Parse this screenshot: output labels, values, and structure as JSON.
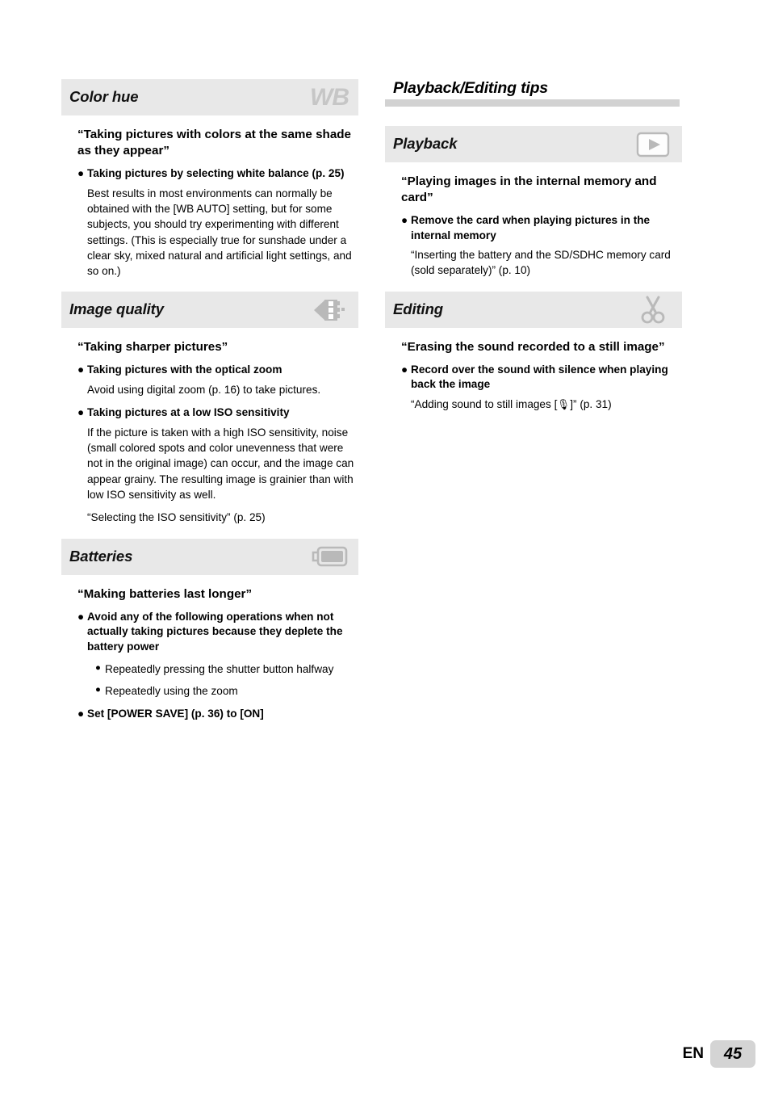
{
  "page": {
    "language_code": "EN",
    "page_number": "45"
  },
  "left_column": {
    "sections": [
      {
        "title": "Color hue",
        "icon": "white-balance-wb-icon",
        "icon_label": "WB",
        "quoted_heading": "“Taking pictures with colors at the same shade as they appear”",
        "bullets": [
          {
            "level": 1,
            "bold": true,
            "text": "Taking pictures by selecting white balance (p. 25)"
          }
        ],
        "paragraphs": [
          "Best results in most environments can normally be obtained with the [WB AUTO] setting, but for some subjects, you should try experimenting with different settings. (This is especially true for sunshade under a clear sky, mixed natural and artificial light settings, and so on.)"
        ]
      },
      {
        "title": "Image quality",
        "icon": "pixel-arrow-image-quality-icon",
        "quoted_heading": "“Taking sharper pictures”",
        "bullet_1_text": "Taking pictures with the optical zoom",
        "bullet_1_para": "Avoid using digital zoom (p. 16) to take pictures.",
        "bullet_2_text": "Taking pictures at a low ISO sensitivity",
        "bullet_2_para": "If the picture is taken with a high ISO sensitivity, noise (small colored spots and color unevenness that were not in the original image) can occur, and the image can appear grainy. The resulting image is grainier than with low ISO sensitivity as well.",
        "reference": "“Selecting the ISO sensitivity” (p. 25)"
      },
      {
        "title": "Batteries",
        "icon": "battery-icon",
        "quoted_heading": "“Making batteries last longer”",
        "bullet_1_text": "Avoid any of the following operations when not actually taking pictures because they deplete the battery power",
        "sub_bullets": [
          "Repeatedly pressing the shutter button halfway",
          "Repeatedly using the zoom"
        ],
        "bullet_2_text": "Set [POWER SAVE] (p. 36) to [ON]"
      }
    ]
  },
  "right_column": {
    "main_title": "Playback/Editing tips",
    "sections": [
      {
        "title": "Playback",
        "icon": "play-button-icon",
        "quoted_heading": "“Playing images in the internal memory and card”",
        "bullet_1_text": "Remove the card when playing pictures in the internal memory",
        "reference": "“Inserting the battery and the SD/SDHC memory card (sold separately)” (p. 10)"
      },
      {
        "title": "Editing",
        "icon": "scissors-icon",
        "quoted_heading": "“Erasing the sound recorded to a still image”",
        "bullet_1_text": "Record over the sound with silence when playing back the image",
        "reference_prefix": "“Adding sound to still images [",
        "reference_glyph": "🎙",
        "reference_suffix": "]” (p. 31)"
      }
    ]
  },
  "colors": {
    "section_band": "#e8e8e8",
    "title_rule": "#d2d2d2",
    "icon_gray": "#b9b9b9",
    "page_badge": "#d4d4d4"
  }
}
